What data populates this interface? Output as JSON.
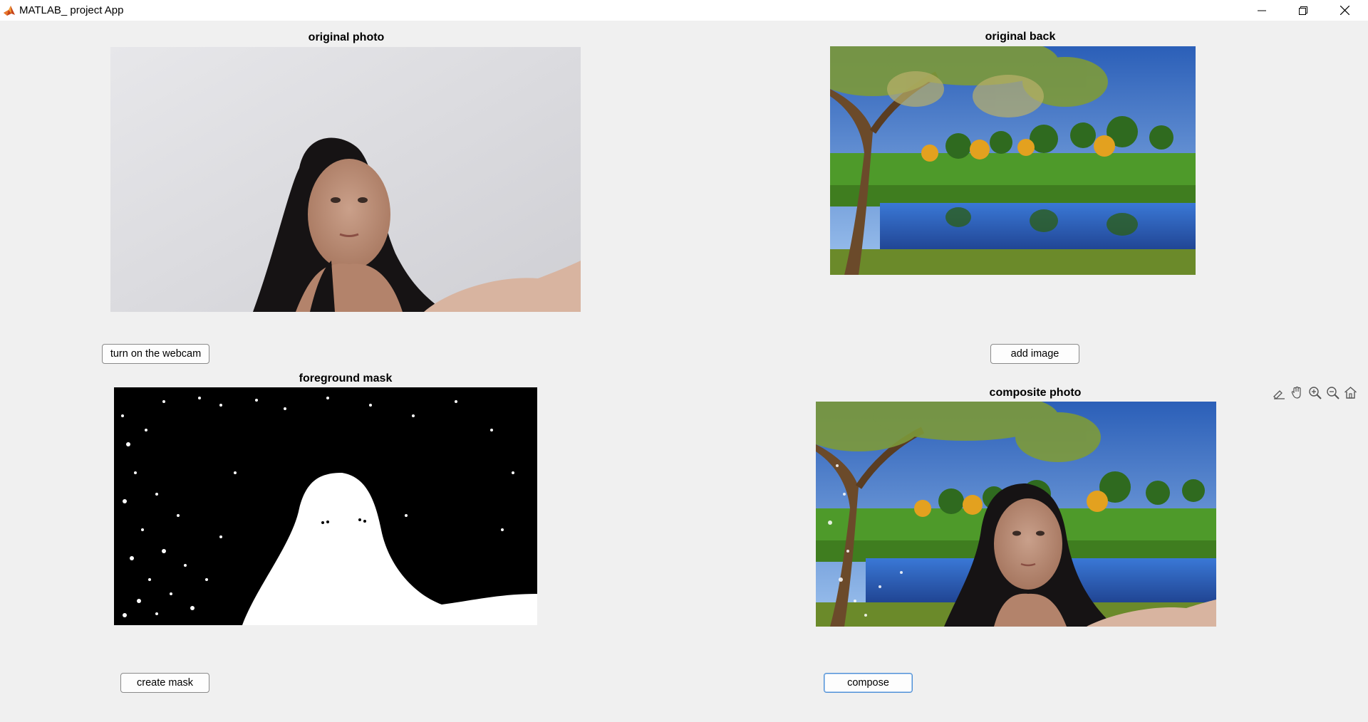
{
  "window": {
    "title": "MATLAB_ project App",
    "controls": [
      "minimize-icon",
      "restore-icon",
      "close-icon"
    ]
  },
  "panels": {
    "original_photo": {
      "title": "original photo"
    },
    "original_back": {
      "title": "original back"
    },
    "foreground_mask": {
      "title": "foreground mask"
    },
    "composite_photo": {
      "title": "composite photo"
    }
  },
  "buttons": {
    "webcam": "turn on the webcam",
    "add_image": "add image",
    "create_mask": "create mask",
    "compose": "compose"
  },
  "axes_toolbar": [
    "brush-icon",
    "pan-hand-icon",
    "zoom-in-icon",
    "zoom-out-icon",
    "home-icon"
  ]
}
